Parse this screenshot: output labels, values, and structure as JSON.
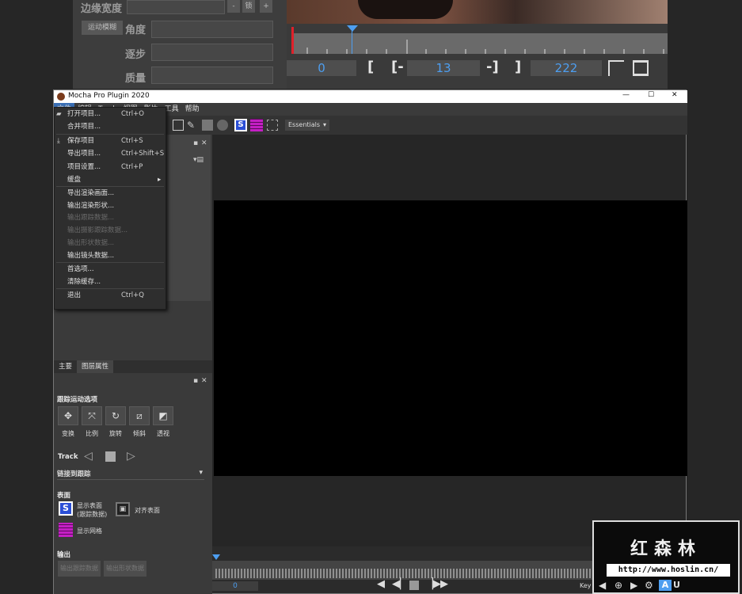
{
  "host": {
    "labels": {
      "edge_width": "边缘宽度",
      "angle": "角度",
      "step": "逐步",
      "quality": "质量"
    },
    "motion_blur_btn": "运动模糊",
    "small_buttons": [
      "-",
      "锁",
      "+"
    ],
    "timecodes": {
      "in": "0",
      "duration": "13",
      "out": "222"
    },
    "brackets": {
      "open": "[",
      "open_minus": "[-",
      "close_minus": "-]",
      "close": "]"
    }
  },
  "window": {
    "title": "Mocha Pro Plugin 2020",
    "controls": {
      "minimize": "—",
      "maximize": "☐",
      "close": "✕"
    }
  },
  "menubar": [
    "文件",
    "编辑",
    "Track",
    "视图",
    "影片",
    "工具",
    "帮助"
  ],
  "toolbar": {
    "workspace": "Essentials"
  },
  "file_menu": [
    {
      "label": "打开项目...",
      "shortcut": "Ctrl+O"
    },
    {
      "label": "合并项目...",
      "shortcut": ""
    },
    {
      "label": "保存项目",
      "shortcut": "Ctrl+S"
    },
    {
      "label": "导出项目...",
      "shortcut": "Ctrl+Shift+S"
    },
    {
      "label": "项目设置...",
      "shortcut": "Ctrl+P"
    },
    {
      "label": "缓盘",
      "shortcut": ""
    },
    {
      "label": "导出渲染画面...",
      "shortcut": ""
    },
    {
      "label": "输出渲染形状...",
      "shortcut": ""
    },
    {
      "label": "输出跟踪数据...",
      "shortcut": ""
    },
    {
      "label": "输出摄影跟踪数据...",
      "shortcut": ""
    },
    {
      "label": "输出形状数据...",
      "shortcut": ""
    },
    {
      "label": "输出镜头数据...",
      "shortcut": ""
    },
    {
      "label": "首选项...",
      "shortcut": ""
    },
    {
      "label": "清除缓存...",
      "shortcut": ""
    },
    {
      "label": "退出",
      "shortcut": "Ctrl+Q"
    }
  ],
  "panel_tabs": [
    "主要",
    "图层属性"
  ],
  "motion": {
    "title": "跟踪运动选项",
    "buttons": [
      "变换",
      "比例",
      "旋转",
      "倾斜",
      "透视"
    ]
  },
  "track": {
    "label": "Track"
  },
  "link": {
    "label": "链接到跟踪"
  },
  "surface": {
    "title": "表面",
    "show_surface": "显示表面",
    "show_surface_sub": "(跟踪数据)",
    "align_surface": "对齐表面",
    "show_grid": "显示网格"
  },
  "output": {
    "title": "输出",
    "btn1": "输出跟踪数据",
    "btn2": "输出形状数据"
  },
  "timeline": {
    "frame": "0",
    "key_label": "Key"
  },
  "watermark": {
    "title": "红森林",
    "url": "http://www.hoslin.cn/"
  },
  "colors": {
    "accent_blue": "#4d9ef0",
    "playhead": "#e0202a",
    "surface_blue": "#2b4fd6",
    "grid_magenta": "#c41fc4"
  }
}
